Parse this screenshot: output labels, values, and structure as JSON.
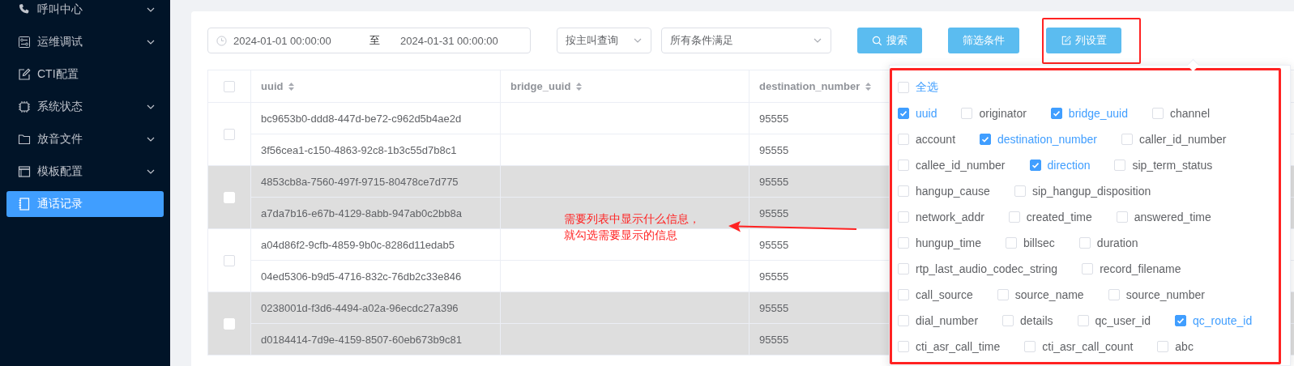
{
  "sidebar": {
    "items": [
      {
        "label": "呼叫中心",
        "expandable": true,
        "selected": false
      },
      {
        "label": "运维调试",
        "expandable": true,
        "selected": false
      },
      {
        "label": "CTI配置",
        "expandable": false,
        "selected": false
      },
      {
        "label": "系统状态",
        "expandable": true,
        "selected": false
      },
      {
        "label": "放音文件",
        "expandable": true,
        "selected": false
      },
      {
        "label": "模板配置",
        "expandable": true,
        "selected": false
      },
      {
        "label": "通话记录",
        "expandable": false,
        "selected": true
      }
    ]
  },
  "query_bar": {
    "date_range": {
      "start": "2024-01-01 00:00:00",
      "separator": "至",
      "end": "2024-01-31 00:00:00"
    },
    "selects": [
      {
        "value": "按主叫查询"
      },
      {
        "value": "所有条件满足"
      }
    ],
    "buttons": [
      {
        "label": "搜索"
      },
      {
        "label": "筛选条件"
      },
      {
        "label": "列设置"
      }
    ]
  },
  "table": {
    "select_all_checked": false,
    "columns": [
      {
        "label": "uuid"
      },
      {
        "label": "bridge_uuid"
      },
      {
        "label": "destination_number"
      }
    ],
    "groups": [
      {
        "checked": false,
        "shaded": false,
        "rows": [
          {
            "uuid": "bc9653b0-ddd8-447d-be72-c962d5b4ae2d",
            "destination_number": "95555"
          },
          {
            "uuid": "3f56cea1-c150-4863-92c8-1b3c55d7b8c1",
            "destination_number": "95555"
          }
        ]
      },
      {
        "checked": false,
        "shaded": true,
        "rows": [
          {
            "uuid": "4853cb8a-7560-497f-9715-80478ce7d775",
            "destination_number": "95555"
          },
          {
            "uuid": "a7da7b16-e67b-4129-8abb-947ab0c2bb8a",
            "destination_number": "95555"
          }
        ]
      },
      {
        "checked": false,
        "shaded": false,
        "rows": [
          {
            "uuid": "a04d86f2-9cfb-4859-9b0c-8286d11edab5",
            "destination_number": "95555"
          },
          {
            "uuid": "04ed5306-b9d5-4716-832c-76db2c33e846",
            "destination_number": "95555"
          }
        ]
      },
      {
        "checked": false,
        "shaded": true,
        "rows": [
          {
            "uuid": "0238001d-f3d6-4494-a02a-96ecdc27a396",
            "destination_number": "95555"
          },
          {
            "uuid": "d0184414-7d9e-4159-8507-60eb673b9c81",
            "destination_number": "95555"
          }
        ]
      }
    ]
  },
  "column_settings": {
    "select_all": {
      "label": "全选",
      "checked": false
    },
    "rows": [
      [
        {
          "label": "uuid",
          "checked": true
        },
        {
          "label": "originator",
          "checked": false
        },
        {
          "label": "bridge_uuid",
          "checked": true
        },
        {
          "label": "channel",
          "checked": false
        }
      ],
      [
        {
          "label": "account",
          "checked": false
        },
        {
          "label": "destination_number",
          "checked": true
        },
        {
          "label": "caller_id_number",
          "checked": false
        }
      ],
      [
        {
          "label": "callee_id_number",
          "checked": false
        },
        {
          "label": "direction",
          "checked": true
        },
        {
          "label": "sip_term_status",
          "checked": false
        }
      ],
      [
        {
          "label": "hangup_cause",
          "checked": false
        },
        {
          "label": "sip_hangup_disposition",
          "checked": false
        }
      ],
      [
        {
          "label": "network_addr",
          "checked": false
        },
        {
          "label": "created_time",
          "checked": false
        },
        {
          "label": "answered_time",
          "checked": false
        }
      ],
      [
        {
          "label": "hungup_time",
          "checked": false
        },
        {
          "label": "billsec",
          "checked": false
        },
        {
          "label": "duration",
          "checked": false
        }
      ],
      [
        {
          "label": "rtp_last_audio_codec_string",
          "checked": false
        },
        {
          "label": "record_filename",
          "checked": false
        }
      ],
      [
        {
          "label": "call_source",
          "checked": false
        },
        {
          "label": "source_name",
          "checked": false
        },
        {
          "label": "source_number",
          "checked": false
        }
      ],
      [
        {
          "label": "dial_number",
          "checked": false
        },
        {
          "label": "details",
          "checked": false
        },
        {
          "label": "qc_user_id",
          "checked": false
        },
        {
          "label": "qc_route_id",
          "checked": true
        }
      ],
      [
        {
          "label": "cti_asr_call_time",
          "checked": false
        },
        {
          "label": "cti_asr_call_count",
          "checked": false
        },
        {
          "label": "abc",
          "checked": false
        }
      ]
    ]
  },
  "annotation": {
    "lines": [
      "需要列表中显示什么信息，",
      "就勾选需要显示的信息"
    ]
  }
}
